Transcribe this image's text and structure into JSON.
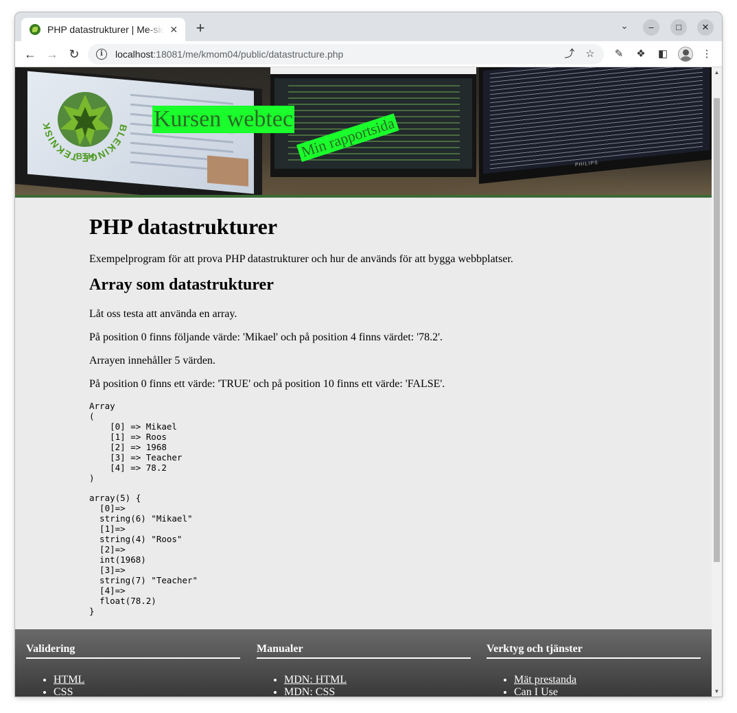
{
  "browser": {
    "tab_title": "PHP datastrukturer | Me-sida",
    "tab_close": "✕",
    "new_tab": "+",
    "url_host": "localhost",
    "url_path": ":18081/me/kmom04/public/datastructure.php",
    "minimize": "–",
    "maximize": "□",
    "close": "✕"
  },
  "header": {
    "site_title": "Kursen webtec",
    "site_slogan": "Min rapportsida",
    "logo_text": "BLEKINGE TEKNISKA HÖGSKOLA",
    "logo_abbrev": "BTH",
    "monitor_brand": "PHILIPS"
  },
  "article": {
    "title": "PHP datastrukturer",
    "intro": "Exempelprogram för att prova PHP datastrukturer och hur de används för att bygga webbplatser.",
    "section_title": "Array som datastrukturer",
    "paragraphs": [
      "Låt oss testa att använda en array.",
      "På position 0 finns följande värde: 'Mikael' och på position 4 finns värdet: '78.2'.",
      "Arrayen innehåller 5 värden.",
      "På position 0 finns ett värde: 'TRUE' och på position 10 finns ett värde: 'FALSE'."
    ],
    "print_r_output": "Array\n(\n    [0] => Mikael\n    [1] => Roos\n    [2] => 1968\n    [3] => Teacher\n    [4] => 78.2\n)",
    "var_dump_output": "array(5) {\n  [0]=>\n  string(6) \"Mikael\"\n  [1]=>\n  string(4) \"Roos\"\n  [2]=>\n  int(1968)\n  [3]=>\n  string(7) \"Teacher\"\n  [4]=>\n  float(78.2)\n}"
  },
  "footer": {
    "columns": [
      {
        "title": "Validering",
        "links": [
          "HTML",
          "CSS"
        ]
      },
      {
        "title": "Manualer",
        "links": [
          "MDN: HTML",
          "MDN: CSS"
        ]
      },
      {
        "title": "Verktyg och tjänster",
        "links": [
          "Mät prestanda",
          "Can I Use"
        ]
      }
    ]
  },
  "colors": {
    "title_bg": "#1aff2c",
    "title_text": "#2a6b25",
    "header_border": "#3c6b36"
  }
}
